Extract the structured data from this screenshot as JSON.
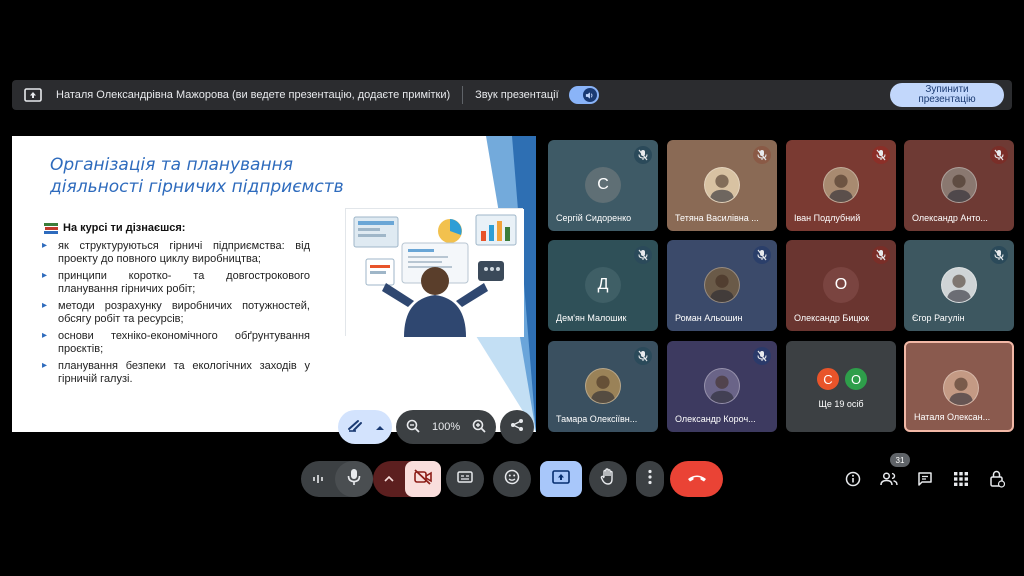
{
  "banner": {
    "presenter_text": "Наталя Олександрівна Мажорова (ви ведете презентацію, додаєте примітки)",
    "sound_label": "Звук презентації",
    "stop_button": "Зупинити презентацію"
  },
  "slide": {
    "title_line1": "Організація та планування",
    "title_line2": "діяльності гірничих підприємств",
    "heading": "На курсі ти дізнаєшся:",
    "bullets": [
      "як структуруються гірничі підприємства: від проекту до повного циклу виробництва;",
      "принципи коротко- та довгострокового планування гірничих робіт;",
      "методи розрахунку виробничих потужностей, обсягу робіт та ресурсів;",
      "основи техніко-економічного обґрунтування проєктів;",
      "планування безпеки та екологічних заходів у гірничій галузі."
    ],
    "zoom": "100%"
  },
  "participants": [
    {
      "name": "Сергій Сидоренко",
      "initial": "С",
      "type": "letter",
      "bg": "#3e5a66",
      "avatar_bg": "#5f6f75"
    },
    {
      "name": "Тетяна Василівна ...",
      "initial": "",
      "type": "photo",
      "bg": "#8a6a55",
      "avatar_bg": "#d8c2a2"
    },
    {
      "name": "Іван Подлубний",
      "initial": "",
      "type": "photo",
      "bg": "#7a3a32",
      "avatar_bg": "#a88a70"
    },
    {
      "name": "Олександр Анто...",
      "initial": "",
      "type": "photo",
      "bg": "#6e3a34",
      "avatar_bg": "#8a7870"
    },
    {
      "name": "Дем'ян Малошик",
      "initial": "Д",
      "type": "letter",
      "bg": "#2f5058",
      "avatar_bg": "#3f5f66"
    },
    {
      "name": "Роман Альошин",
      "initial": "",
      "type": "photo",
      "bg": "#3b4a6a",
      "avatar_bg": "#6a5a48"
    },
    {
      "name": "Олександр Бицюк",
      "initial": "О",
      "type": "letter",
      "bg": "#6a3530",
      "avatar_bg": "#7a4440"
    },
    {
      "name": "Єгор Рагулін",
      "initial": "",
      "type": "photo",
      "bg": "#3d5760",
      "avatar_bg": "#cfd4d6"
    },
    {
      "name": "Тамара Олексіївн...",
      "initial": "",
      "type": "photo",
      "bg": "#3a5060",
      "avatar_bg": "#9a8258"
    },
    {
      "name": "Олександр Короч...",
      "initial": "",
      "type": "photo",
      "bg": "#3d3a60",
      "avatar_bg": "#6a6488"
    },
    {
      "name": "Наталя Олексан...",
      "initial": "",
      "type": "photo",
      "bg": "#8a5a4e",
      "avatar_bg": "#c49a84"
    }
  ],
  "more": {
    "label": "Ще 19 осіб",
    "circle1": "С",
    "circle2": "О",
    "circle1_color": "#e8542a",
    "circle2_color": "#2e9e4a"
  },
  "toolbar": {
    "people_count": "31"
  },
  "colors": {
    "end_call": "#ea4335",
    "camera_off": "#f9dedc",
    "present_active": "#a8c7fa",
    "accent": "#8ab4f8"
  }
}
